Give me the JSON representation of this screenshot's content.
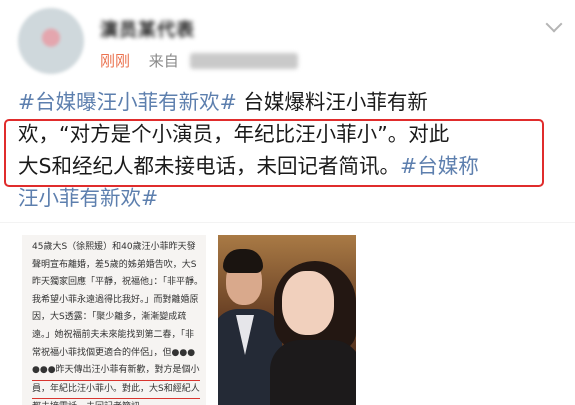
{
  "header": {
    "username": "演员某代表",
    "time": "刚刚",
    "source_prefix": "来自"
  },
  "post": {
    "lines": [
      [
        {
          "text": "#台媒曝汪小菲有新欢#",
          "tag": true
        },
        {
          "text": " 台媒爆料汪小菲有新",
          "tag": false
        }
      ],
      [
        {
          "text": "欢，“对方是个小演员，年纪比汪小菲小”。对此",
          "tag": false
        }
      ],
      [
        {
          "text": "大S和经纪人都未接电话，未回记者简讯。",
          "tag": false
        },
        {
          "text": "#台媒称",
          "tag": true
        }
      ],
      [
        {
          "text": "汪小菲有新欢#",
          "tag": true
        }
      ]
    ]
  },
  "colors": {
    "link": "#5d7fae",
    "time": "#eb7350",
    "highlight": "#e02c2c"
  },
  "article": {
    "lines": [
      "45歲大S（徐熙媛）和40歲汪小菲昨天發",
      "聲明宣布離婚，差5歲的姊弟婚告吹，大S",
      "昨天獨家回應「平靜，祝福他」：「非平靜。",
      "我希望小菲永遠過得比我好。」而對離婚原",
      "因，大S透露：「聚少離多，漸漸變成疏",
      "遠。」她祝福前夫未來能找到第二春，「非",
      "常祝福小菲找個更適合的伴侶」，但●●●",
      "●●●昨天傳出汪小菲有新歡，對方是個小演",
      "員，年紀比汪小菲小。對此，大S和經紀人",
      "都未接電話、未回記者簡訊。"
    ]
  }
}
